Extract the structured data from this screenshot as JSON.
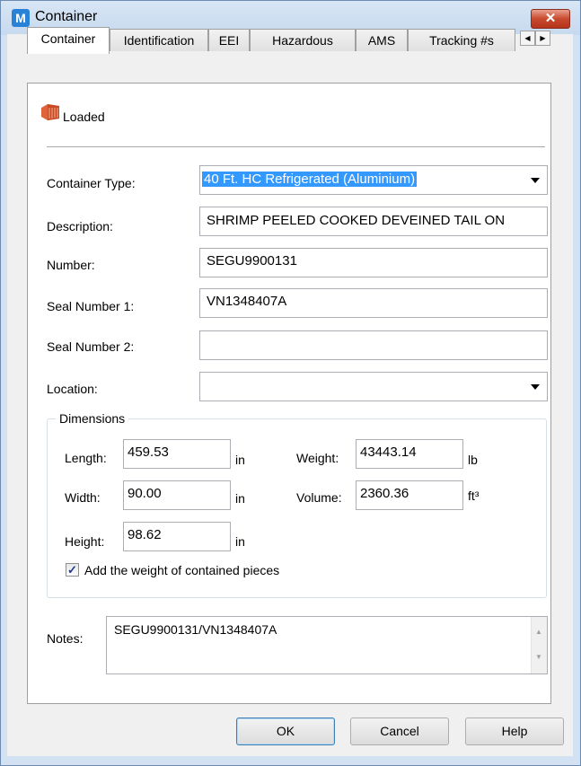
{
  "window": {
    "title": "Container",
    "app_icon": "M",
    "close_glyph": "✕"
  },
  "tabs": [
    {
      "label": "Container"
    },
    {
      "label": "Identification"
    },
    {
      "label": "EEI"
    },
    {
      "label": "Hazardous"
    },
    {
      "label": "AMS"
    },
    {
      "label": "Tracking #s"
    }
  ],
  "tab_scroll": {
    "left": "◀",
    "right": "▶"
  },
  "status": {
    "label": "Loaded",
    "icon": "container-icon",
    "icon_color": "#e0633a"
  },
  "form": {
    "container_type": {
      "label": "Container Type:",
      "value": "40 Ft. HC Refrigerated (Aluminium)"
    },
    "description": {
      "label": "Description:",
      "value": "SHRIMP PEELED COOKED DEVEINED TAIL ON"
    },
    "number": {
      "label": "Number:",
      "value": "SEGU9900131"
    },
    "seal1": {
      "label": "Seal Number 1:",
      "value": "VN1348407A"
    },
    "seal2": {
      "label": "Seal Number 2:",
      "value": ""
    },
    "location": {
      "label": "Location:",
      "value": ""
    }
  },
  "dimensions": {
    "title": "Dimensions",
    "length": {
      "label": "Length:",
      "value": "459.53",
      "unit": "in"
    },
    "width": {
      "label": "Width:",
      "value": "90.00",
      "unit": "in"
    },
    "height": {
      "label": "Height:",
      "value": "98.62",
      "unit": "in"
    },
    "weight": {
      "label": "Weight:",
      "value": "43443.14",
      "unit": "lb"
    },
    "volume": {
      "label": "Volume:",
      "value": "2360.36",
      "unit": "ft³"
    },
    "add_weight": {
      "label": "Add the weight of contained pieces",
      "checked": true,
      "mark": "✓"
    }
  },
  "notes": {
    "label": "Notes:",
    "value": "SEGU9900131/VN1348407A",
    "scroll_up": "▲",
    "scroll_down": "▼"
  },
  "buttons": {
    "ok": "OK",
    "cancel": "Cancel",
    "help": "Help"
  },
  "colors": {
    "selection": "#3399ff",
    "title_bar": "#c6d9ee",
    "close": "#c74a2e"
  }
}
